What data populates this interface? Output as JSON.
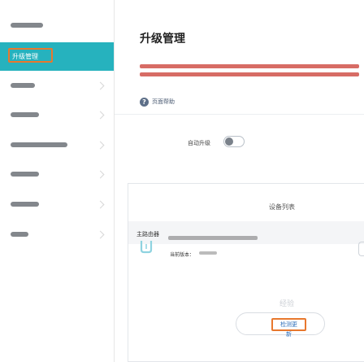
{
  "sidebar": {
    "active_item_label": "升级管理"
  },
  "main": {
    "page_title": "升级管理",
    "help_link_label": "页面帮助",
    "help_icon_glyph": "?",
    "auto_upgrade_label": "自动升级",
    "auto_upgrade_enabled": false,
    "device_list_title": "设备列表",
    "group_label": "主路由器",
    "current_version_label": "当前版本：",
    "check_update_label": "检测更新"
  },
  "watermark_text": "经验",
  "colors": {
    "accent": "#26b2be",
    "highlight_box": "#e8782e",
    "link": "#2d6fba"
  }
}
